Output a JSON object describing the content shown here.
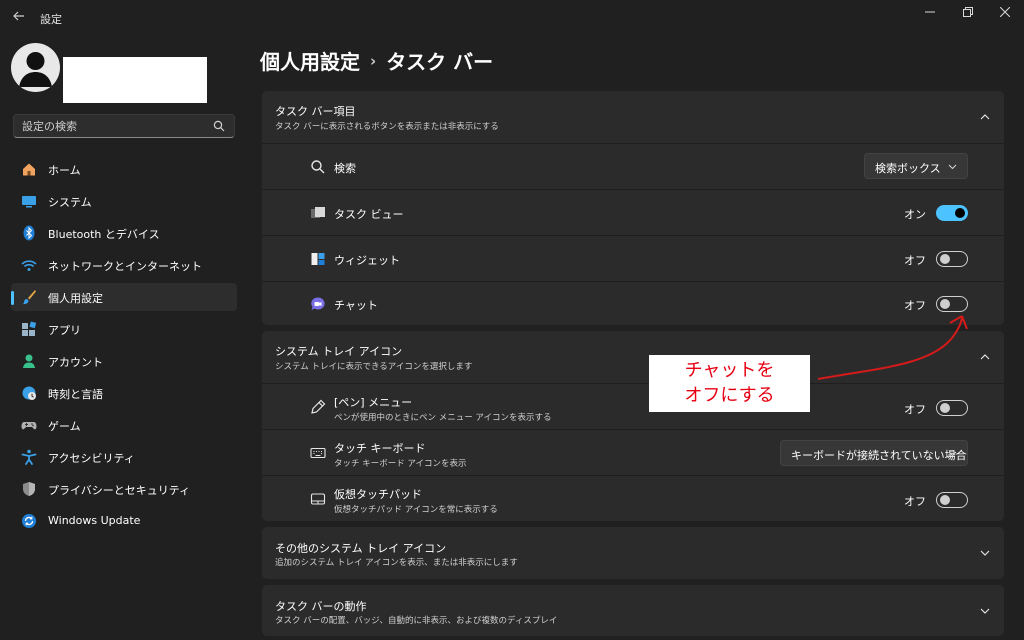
{
  "window": {
    "title": "設定"
  },
  "search": {
    "placeholder": "設定の検索"
  },
  "nav": [
    {
      "label": "ホーム",
      "icon": "home-icon"
    },
    {
      "label": "システム",
      "icon": "system-icon"
    },
    {
      "label": "Bluetooth とデバイス",
      "icon": "bluetooth-icon"
    },
    {
      "label": "ネットワークとインターネット",
      "icon": "wifi-icon"
    },
    {
      "label": "個人用設定",
      "icon": "brush-icon",
      "active": true
    },
    {
      "label": "アプリ",
      "icon": "apps-icon"
    },
    {
      "label": "アカウント",
      "icon": "account-icon"
    },
    {
      "label": "時刻と言語",
      "icon": "time-language-icon"
    },
    {
      "label": "ゲーム",
      "icon": "gamepad-icon"
    },
    {
      "label": "アクセシビリティ",
      "icon": "accessibility-icon"
    },
    {
      "label": "プライバシーとセキュリティ",
      "icon": "shield-icon"
    },
    {
      "label": "Windows Update",
      "icon": "update-icon"
    }
  ],
  "breadcrumb": {
    "parent": "個人用設定",
    "separator": "›",
    "current": "タスク バー"
  },
  "taskbar_items": {
    "title": "タスク バー項目",
    "subtitle": "タスク バーに表示されるボタンを表示または非表示にする",
    "rows": [
      {
        "label": "検索",
        "control": "dropdown",
        "value": "検索ボックス",
        "icon": "search-icon"
      },
      {
        "label": "タスク ビュー",
        "control": "toggle",
        "state": "オン",
        "on": true,
        "icon": "task-view-icon"
      },
      {
        "label": "ウィジェット",
        "control": "toggle",
        "state": "オフ",
        "on": false,
        "icon": "widgets-icon"
      },
      {
        "label": "チャット",
        "control": "toggle",
        "state": "オフ",
        "on": false,
        "icon": "chat-icon"
      }
    ]
  },
  "system_tray": {
    "title": "システム トレイ アイコン",
    "subtitle": "システム トレイに表示できるアイコンを選択します",
    "rows": [
      {
        "label": "[ペン] メニュー",
        "sub": "ペンが使用中のときにペン メニュー アイコンを表示する",
        "control": "toggle",
        "state": "オフ",
        "on": false,
        "icon": "pen-icon"
      },
      {
        "label": "タッチ キーボード",
        "sub": "タッチ キーボード アイコンを表示",
        "control": "dropdown",
        "value": "キーボードが接続されていない場合",
        "icon": "keyboard-icon"
      },
      {
        "label": "仮想タッチパッド",
        "sub": "仮想タッチパッド アイコンを常に表示する",
        "control": "toggle",
        "state": "オフ",
        "on": false,
        "icon": "touchpad-icon"
      }
    ]
  },
  "other_tray": {
    "title": "その他のシステム トレイ アイコン",
    "subtitle": "追加のシステム トレイ アイコンを表示、または非表示にします"
  },
  "behaviors": {
    "title": "タスク バーの動作",
    "subtitle": "タスク バーの配置、バッジ、自動的に非表示、および複数のディスプレイ"
  },
  "annotation": {
    "line1": "チャットを",
    "line2": "オフにする"
  },
  "colors": {
    "accent": "#4cc2ff",
    "annotation": "#e60012",
    "background": "#202020",
    "card": "#2b2b2b"
  }
}
